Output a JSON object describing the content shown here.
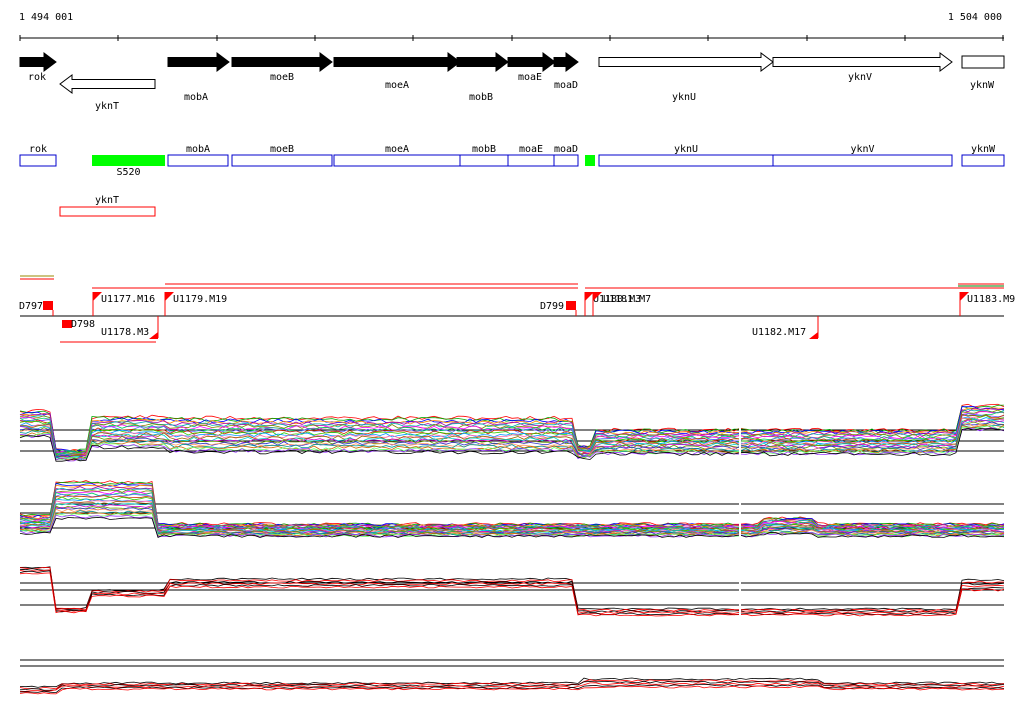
{
  "coords": {
    "start": "1 494 001",
    "end": "1 504 000"
  },
  "colors": {
    "gene_fill": "#000000",
    "gene_open": "#ffffff",
    "feature_blue": "#0000cc",
    "feature_red": "#ff0000",
    "feature_green": "#00ff00",
    "line_black": "#000000",
    "line_red": "#ff0000"
  },
  "genes": [
    {
      "name": "rok",
      "strand": "+",
      "filled": true
    },
    {
      "name": "yknT",
      "strand": "-",
      "filled": false
    },
    {
      "name": "mobA",
      "strand": "+",
      "filled": true
    },
    {
      "name": "moeB",
      "strand": "+",
      "filled": true
    },
    {
      "name": "moeA",
      "strand": "+",
      "filled": true
    },
    {
      "name": "mobB",
      "strand": "+",
      "filled": true
    },
    {
      "name": "moaE",
      "strand": "+",
      "filled": true
    },
    {
      "name": "moaD",
      "strand": "+",
      "filled": true
    },
    {
      "name": "yknU",
      "strand": "+",
      "filled": false
    },
    {
      "name": "yknV",
      "strand": "+",
      "filled": false
    },
    {
      "name": "yknW",
      "strand": "+",
      "filled": false
    }
  ],
  "blue_features": [
    "rok",
    "mobA",
    "moeB",
    "moeA",
    "mobB",
    "moaE",
    "moaD",
    "yknU",
    "yknV",
    "yknW"
  ],
  "green_features": [
    {
      "label": "S520"
    },
    {
      "label": ""
    }
  ],
  "red_feature": {
    "label": "yknT"
  },
  "markers": [
    "D797",
    "U1177.M16",
    "U1179.M19",
    "D799",
    "U1180.M3",
    "U1181.M7",
    "U1183.M9",
    "D798",
    "U1178.M3",
    "U1182.M17"
  ]
}
